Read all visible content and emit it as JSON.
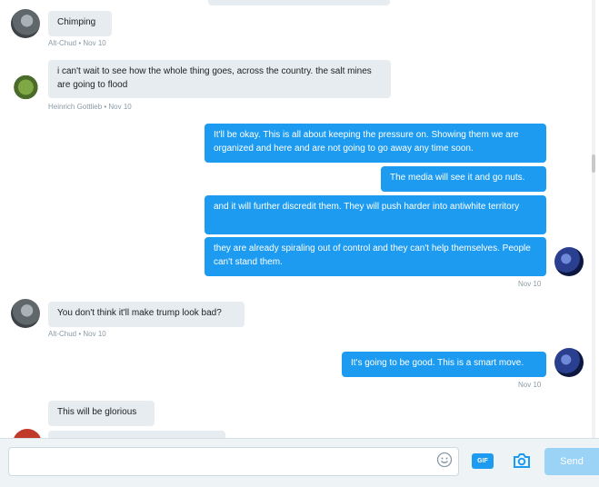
{
  "messages": [
    {
      "side": "in",
      "text": "Chimping",
      "meta": "Alt-Chud • Nov 10"
    },
    {
      "side": "in",
      "text": "i can't wait to see how the whole thing goes, across the country. the salt mines are going to flood",
      "meta": "Heinrich Gottlieb • Nov 10"
    },
    {
      "side": "out",
      "text": "It'll be okay. This is all about keeping the pressure on. Showing them we are organized and here and are not going to go away any time soon."
    },
    {
      "side": "out",
      "text": "The media will see it and go nuts."
    },
    {
      "side": "out",
      "text": "and it will further discredit them. They will push harder into antiwhite territory"
    },
    {
      "side": "out",
      "text": "they are already spiraling out of control and they can't help themselves. People can't stand them.",
      "meta": "Nov 10"
    },
    {
      "side": "in",
      "text": "You don't think it'll make trump look bad?",
      "meta": "Alt-Chud • Nov 10"
    },
    {
      "side": "out",
      "text": "It's going to be good. This is a smart move.",
      "meta": "Nov 10"
    },
    {
      "side": "in",
      "text": "This will be glorious"
    }
  ],
  "composer": {
    "placeholder": "",
    "gif_label": "GIF",
    "send_label": "Send"
  },
  "icons": {
    "emoji": "smiley-icon",
    "camera": "camera-icon"
  },
  "colors": {
    "outgoing_bubble": "#1d9bf0",
    "incoming_bubble": "#e6ecf0",
    "send_disabled": "#9bd3f7"
  }
}
